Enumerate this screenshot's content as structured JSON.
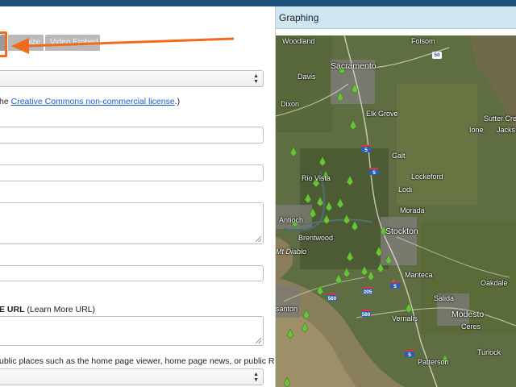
{
  "tabs": [
    {
      "label": ""
    },
    {
      "label": "…mize"
    },
    {
      "label": "Video Embed"
    }
  ],
  "license_text_prefix": "he ",
  "license_link": "Creative Commons non-commercial license",
  "license_text_suffix": ".)",
  "learn_more_label": "E URL",
  "learn_more_hint": " (Learn More URL)",
  "public_places_label": "ublic places such as the home page viewer, home page news, or public RSS Feeds?)",
  "map_header_title": "Graphing",
  "map_labels": {
    "woodland": "Woodland",
    "folsom": "Folsom",
    "davis": "Davis",
    "sacramento": "Sacramento",
    "dixon": "Dixon",
    "elk_grove": "Elk Grove",
    "sutter_creek": "Sutter Cree",
    "ione": "Ione",
    "jackson": "Jacks",
    "galt": "Galt",
    "rio_vista": "Rio Vista",
    "lockeford": "Lockeford",
    "lodi": "Lodi",
    "morada": "Morada",
    "antioch": "Antioch",
    "stockton": "Stockton",
    "brentwood": "Brentwood",
    "mt_diablo": "Mt Diablo",
    "manteca": "Manteca",
    "oakdale": "Oakdale",
    "salida": "Salida",
    "santon": "santon",
    "vernalis": "Vernalis",
    "modesto": "Modesto",
    "ceres": "Ceres",
    "turlock": "Turlock",
    "patterson": "Patterson"
  },
  "highway_shields": [
    "50",
    "5",
    "5",
    "5",
    "205",
    "580",
    "580",
    "5"
  ],
  "colors": {
    "accent_orange": "#f06b1c",
    "header_bg": "#cde6f2",
    "marker_green": "#6cc23a",
    "link_blue": "#1a5bd8"
  }
}
